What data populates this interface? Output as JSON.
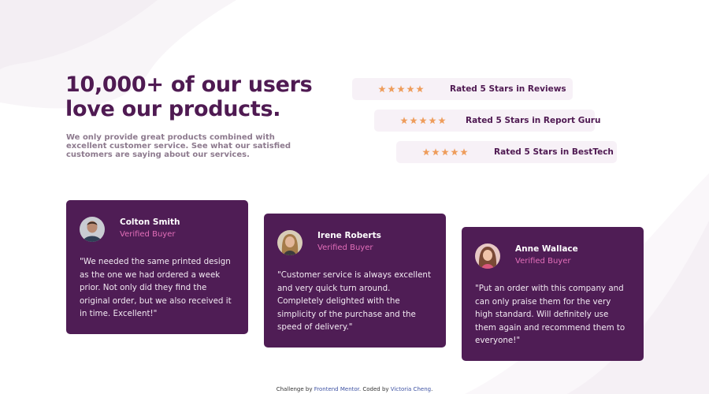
{
  "hero": {
    "title": "10,000+ of our users love our products.",
    "intro": "We only provide great products combined with excellent customer service. See what our satisfied customers are saying about our services."
  },
  "ratings": [
    {
      "stars": 5,
      "label": "Rated 5 Stars in Reviews"
    },
    {
      "stars": 5,
      "label": "Rated 5 Stars in Report Guru"
    },
    {
      "stars": 5,
      "label": "Rated 5 Stars in BestTech"
    }
  ],
  "testimonials": [
    {
      "name": "Colton Smith",
      "badge": "Verified Buyer",
      "quote": "\"We needed the same printed design as the one we had ordered a week prior. Not only did they find the original order, but we also received it in time. Excellent!\""
    },
    {
      "name": "Irene Roberts",
      "badge": "Verified Buyer",
      "quote": "\"Customer service is always excellent and very quick turn around. Completely delighted with the simplicity of the purchase and the speed of delivery.\""
    },
    {
      "name": "Anne Wallace",
      "badge": "Verified Buyer",
      "quote": "\"Put an order with this company and can only praise them for the very high standard. Will definitely use them again and recommend them to everyone!\""
    }
  ],
  "footer": {
    "prefix": "Challenge by",
    "challenge_link": "Frontend Mentor",
    "middle": ". Coded by",
    "author_link": "Victoria Cheng",
    "suffix": "."
  },
  "colors": {
    "primary": "#4f1a52",
    "card_bg": "#4f1d55",
    "accent_pink": "#e26eb9",
    "star_orange": "#ee9d5c",
    "rating_bg": "#f7f1f7"
  },
  "icons": {
    "rating_star": "star-icon",
    "background": "pattern-shapes"
  }
}
